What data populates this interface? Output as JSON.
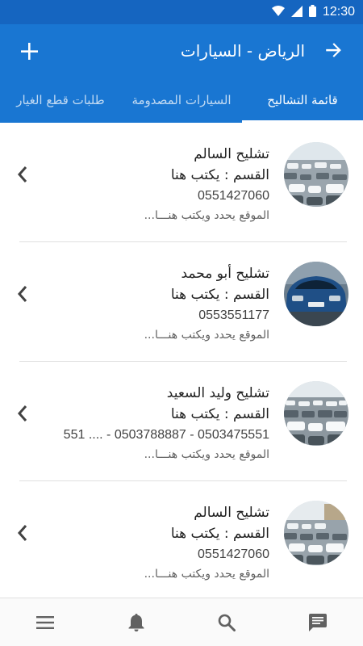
{
  "status_bar": {
    "time": "12:30"
  },
  "app_bar": {
    "title": "الرياض - السيارات"
  },
  "tabs": [
    {
      "label": "قائمة التشاليح",
      "active": true
    },
    {
      "label": "السيارات المصدومة",
      "active": false
    },
    {
      "label": "طلبات قطع الغيار",
      "active": false
    }
  ],
  "list": [
    {
      "name": "تشليح السالم",
      "section": "القسم : يكتب هنا",
      "phone": "0551427060",
      "location": "الموقع يحدد ويكتب هنـــا..."
    },
    {
      "name": "تشليح أبو محمد",
      "section": "القسم : يكتب هنا",
      "phone": "0553551177",
      "location": "الموقع يحدد ويكتب هنـــا..."
    },
    {
      "name": "تشليح وليد السعيد",
      "section": "القسم : يكتب هنا",
      "phone": "551 .... - 0503788887 - 0503475551",
      "location": "الموقع يحدد ويكتب هنـــا..."
    },
    {
      "name": "تشليح السالم",
      "section": "القسم : يكتب هنا",
      "phone": "0551427060",
      "location": "الموقع يحدد ويكتب هنـــا..."
    }
  ],
  "bottom_nav": [
    "menu-icon",
    "bell-icon",
    "search-icon",
    "chat-icon"
  ],
  "colors": {
    "primary": "#1976d2",
    "status_bar": "#1565c0",
    "icon_gray": "#616161"
  }
}
